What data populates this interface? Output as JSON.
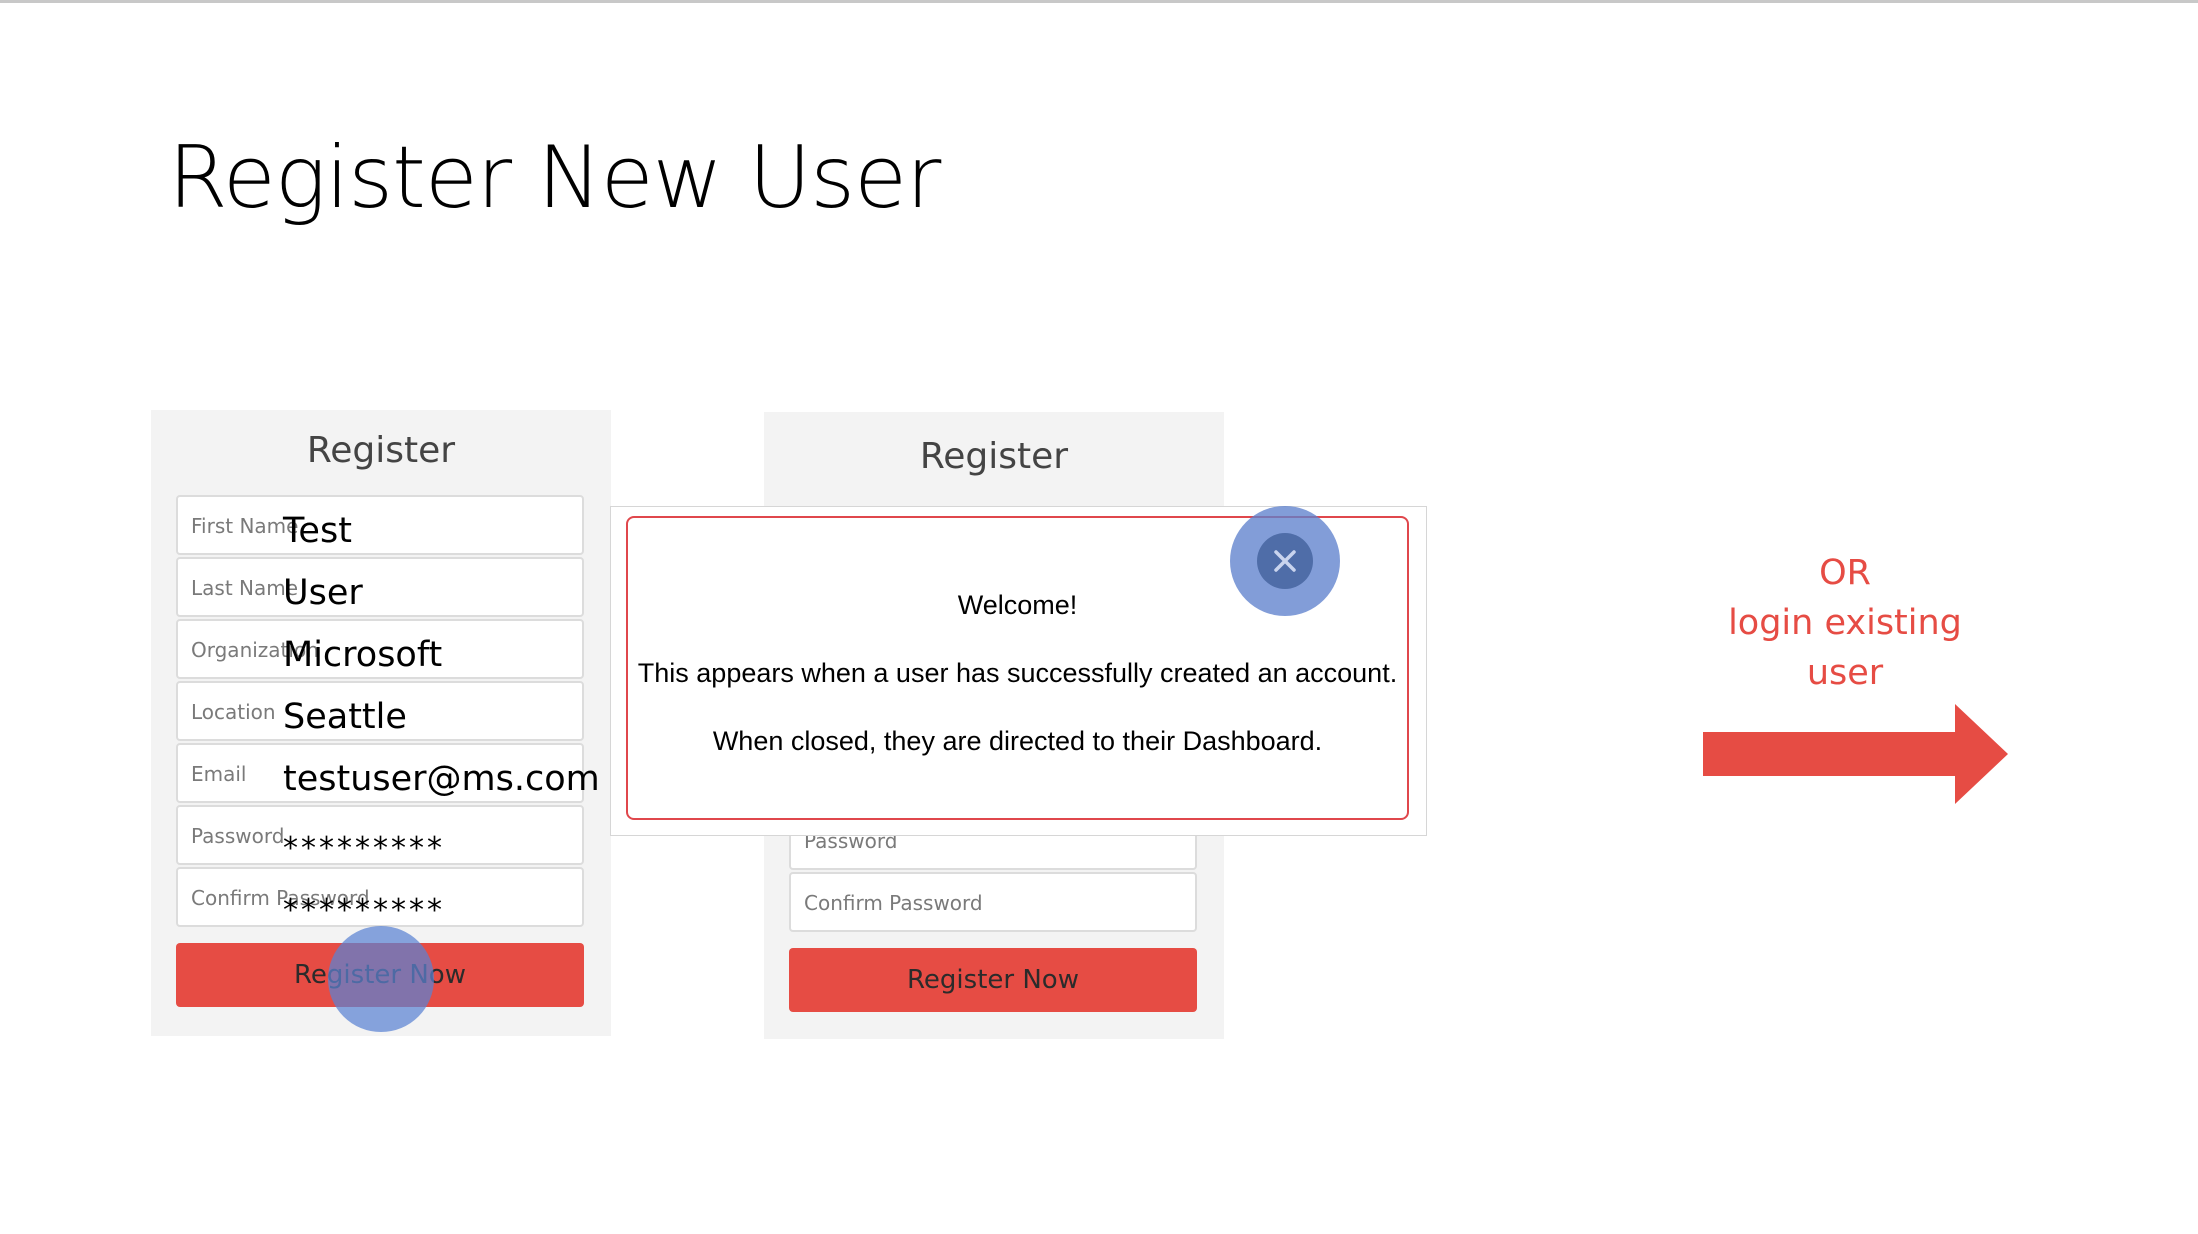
{
  "slide": {
    "title": "Register New User"
  },
  "form_filled": {
    "heading": "Register",
    "fields": [
      {
        "label": "First Name",
        "value": "Test"
      },
      {
        "label": "Last Name",
        "value": "User"
      },
      {
        "label": "Organization",
        "value": "Microsoft"
      },
      {
        "label": "Location",
        "value": "Seattle"
      },
      {
        "label": "Email",
        "value": "testuser@ms.com"
      },
      {
        "label": "Password",
        "value": "*********"
      },
      {
        "label": "Confirm Password",
        "value": "*********"
      }
    ],
    "button_label": "Register Now"
  },
  "form_behind_modal": {
    "heading": "Register",
    "fields": [
      {
        "label": "Password"
      },
      {
        "label": "Confirm Password"
      }
    ],
    "button_label": "Register Now"
  },
  "modal": {
    "title": "Welcome!",
    "line1": "This appears when a user has successfully created an account.",
    "line2": "When closed, they are directed to their Dashboard."
  },
  "side_note": {
    "line1": "OR",
    "line2": "login existing",
    "line3": "user"
  },
  "colors": {
    "accent_red": "#e64c44",
    "click_marker_blue": "#5a82d2"
  }
}
